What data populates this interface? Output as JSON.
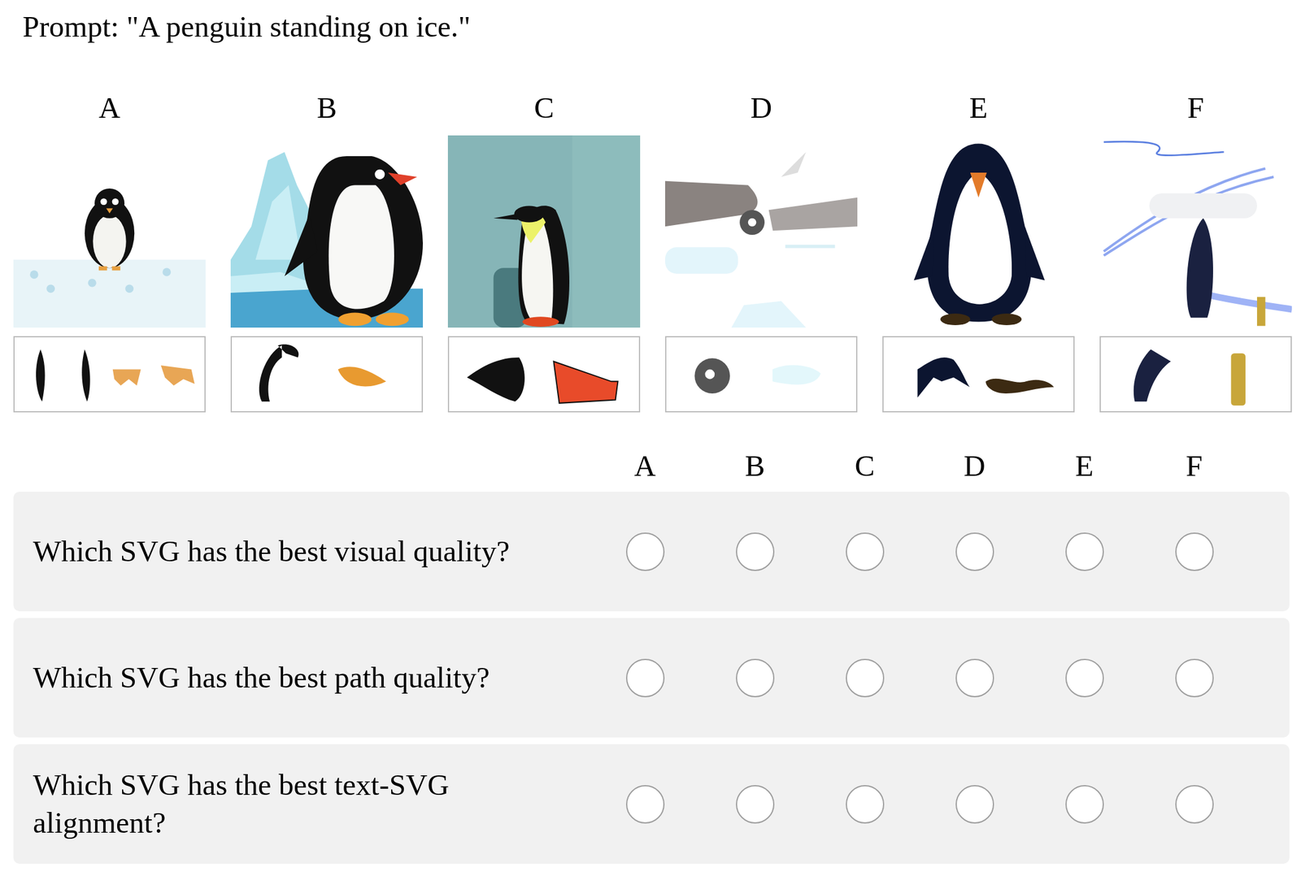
{
  "prompt": "Prompt: \"A penguin standing on ice.\"",
  "options": [
    {
      "label": "A"
    },
    {
      "label": "B"
    },
    {
      "label": "C"
    },
    {
      "label": "D"
    },
    {
      "label": "E"
    },
    {
      "label": "F"
    }
  ],
  "columns": [
    "A",
    "B",
    "C",
    "D",
    "E",
    "F"
  ],
  "questions": [
    {
      "text": "Which SVG has the best visual quality?",
      "choices": [
        {
          "selected": false
        },
        {
          "selected": false
        },
        {
          "selected": false
        },
        {
          "selected": false
        },
        {
          "selected": false
        },
        {
          "selected": false
        }
      ]
    },
    {
      "text": "Which SVG has the best path quality?",
      "choices": [
        {
          "selected": false
        },
        {
          "selected": false
        },
        {
          "selected": false
        },
        {
          "selected": false
        },
        {
          "selected": false
        },
        {
          "selected": false
        }
      ]
    },
    {
      "text": "Which SVG has the best text-SVG alignment?",
      "choices": [
        {
          "selected": false
        },
        {
          "selected": false
        },
        {
          "selected": false
        },
        {
          "selected": false
        },
        {
          "selected": false
        },
        {
          "selected": false
        }
      ]
    }
  ]
}
